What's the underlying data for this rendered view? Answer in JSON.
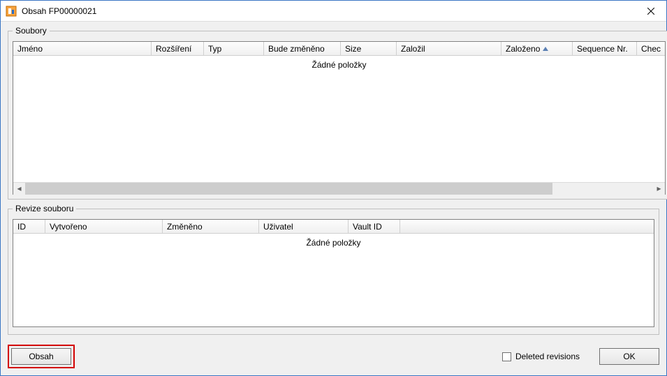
{
  "window": {
    "title": "Obsah  FP00000021"
  },
  "group_files": {
    "legend": "Soubory",
    "columns": {
      "c0": "Jméno",
      "c1": "Rozšíření",
      "c2": "Typ",
      "c3": "Bude změněno",
      "c4": "Size",
      "c5": "Založil",
      "c6": "Založeno",
      "c7": "Sequence Nr.",
      "c8": "Chec"
    },
    "sort_column": "Založeno",
    "empty": "Žádné položky"
  },
  "group_revisions": {
    "legend": "Revize souboru",
    "columns": {
      "c0": "ID",
      "c1": "Vytvořeno",
      "c2": "Změněno",
      "c3": "Uživatel",
      "c4": "Vault ID"
    },
    "empty": "Žádné položky"
  },
  "buttons": {
    "obsah": "Obsah",
    "ok": "OK"
  },
  "checkbox": {
    "deleted_revisions": "Deleted revisions"
  }
}
